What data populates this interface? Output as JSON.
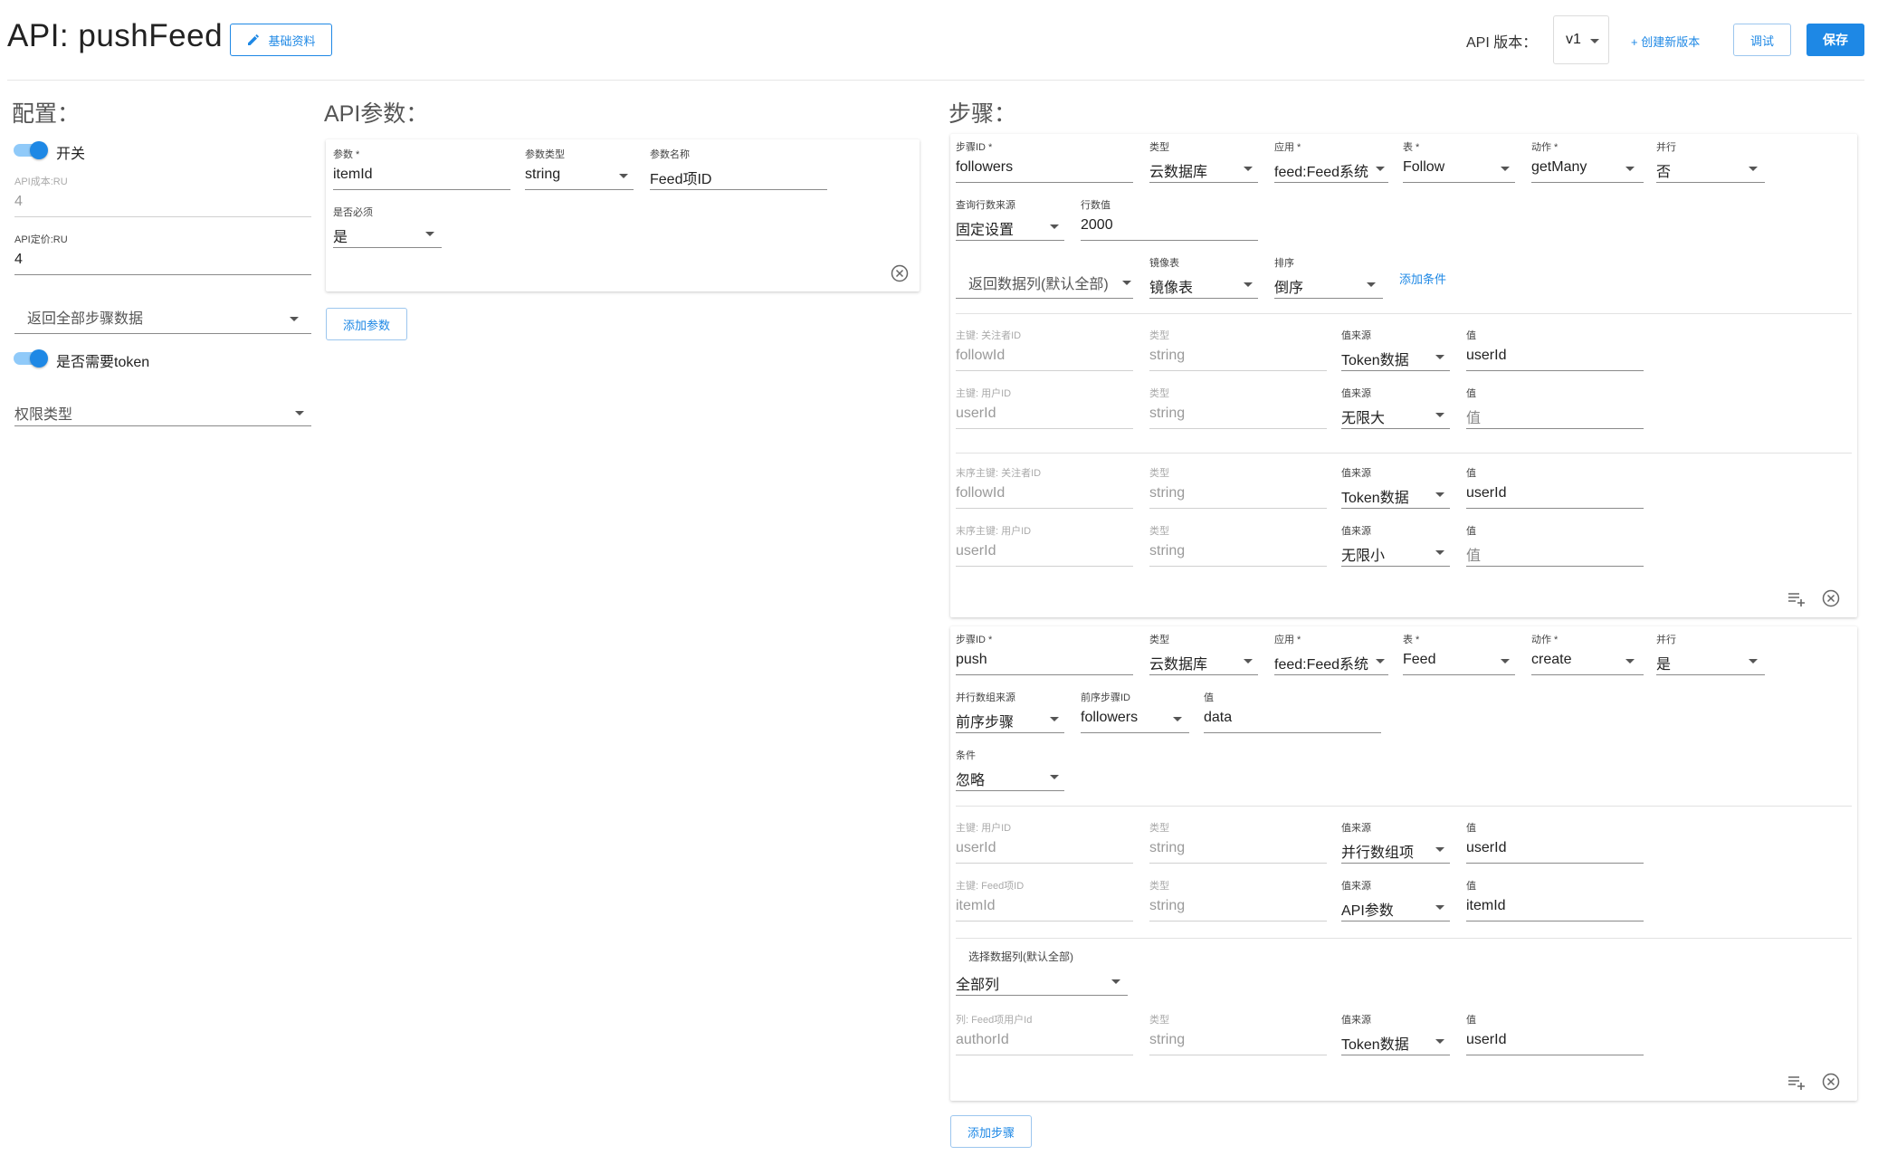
{
  "header": {
    "title": "API: pushFeed",
    "basic_info_btn": "基础资料",
    "version_label": "API 版本：",
    "version_value": "v1",
    "new_version": "+ 创建新版本",
    "debug": "调试",
    "save": "保存"
  },
  "config": {
    "title": "配置：",
    "switch_label": "开关",
    "cost_label": "API成本:RU",
    "cost_value": "4",
    "price_label": "API定价:RU",
    "price_value": "4",
    "return_select": "返回全部步骤数据",
    "token_label": "是否需要token",
    "permission_select": "权限类型"
  },
  "params": {
    "title": "API参数：",
    "param_label": "参数 *",
    "param_value": "itemId",
    "type_label": "参数类型",
    "type_value": "string",
    "name_label": "参数名称",
    "name_value": "Feed项ID",
    "required_label": "是否必须",
    "required_value": "是",
    "add_param": "添加参数"
  },
  "steps": {
    "title": "步骤：",
    "add_step": "添加步骤",
    "step1": {
      "id_label": "步骤ID *",
      "id_value": "followers",
      "type_label": "类型",
      "type_value": "云数据库",
      "app_label": "应用 *",
      "app_value": "feed:Feed系统",
      "table_label": "表 *",
      "table_value": "Follow",
      "action_label": "动作 *",
      "action_value": "getMany",
      "parallel_label": "并行",
      "parallel_value": "否",
      "rowsrc_label": "查询行数来源",
      "rowsrc_value": "固定设置",
      "rowval_label": "行数值",
      "rowval_value": "2000",
      "return_cols": "返回数据列(默认全部)",
      "mirror_label": "镜像表",
      "mirror_value": "镜像表",
      "sort_label": "排序",
      "sort_value": "倒序",
      "add_condition": "添加条件",
      "rows": [
        {
          "k_label": "主键: 关注者ID",
          "k_value": "followId",
          "t_label": "类型",
          "t_value": "string",
          "s_label": "值来源",
          "s_value": "Token数据",
          "v_label": "值",
          "v_value": "userId",
          "v_muted": false
        },
        {
          "k_label": "主键: 用户ID",
          "k_value": "userId",
          "t_label": "类型",
          "t_value": "string",
          "s_label": "值来源",
          "s_value": "无限大",
          "v_label": "值",
          "v_value": "值",
          "v_muted": true
        },
        {
          "k_label": "末序主键: 关注者ID",
          "k_value": "followId",
          "t_label": "类型",
          "t_value": "string",
          "s_label": "值来源",
          "s_value": "Token数据",
          "v_label": "值",
          "v_value": "userId",
          "v_muted": false
        },
        {
          "k_label": "末序主键: 用户ID",
          "k_value": "userId",
          "t_label": "类型",
          "t_value": "string",
          "s_label": "值来源",
          "s_value": "无限小",
          "v_label": "值",
          "v_value": "值",
          "v_muted": true
        }
      ]
    },
    "step2": {
      "id_label": "步骤ID *",
      "id_value": "push",
      "type_label": "类型",
      "type_value": "云数据库",
      "app_label": "应用 *",
      "app_value": "feed:Feed系统",
      "table_label": "表 *",
      "table_value": "Feed",
      "action_label": "动作 *",
      "action_value": "create",
      "parallel_label": "并行",
      "parallel_value": "是",
      "arrsrc_label": "并行数组来源",
      "arrsrc_value": "前序步骤",
      "prev_label": "前序步骤ID",
      "prev_value": "followers",
      "val_label": "值",
      "val_value": "data",
      "cond_label": "条件",
      "cond_value": "忽略",
      "rows": [
        {
          "k_label": "主键: 用户ID",
          "k_value": "userId",
          "t_label": "类型",
          "t_value": "string",
          "s_label": "值来源",
          "s_value": "并行数组项",
          "v_label": "值",
          "v_value": "userId"
        },
        {
          "k_label": "主键: Feed项ID",
          "k_value": "itemId",
          "t_label": "类型",
          "t_value": "string",
          "s_label": "值来源",
          "s_value": "API参数",
          "v_label": "值",
          "v_value": "itemId"
        }
      ],
      "select_cols_label": "选择数据列(默认全部)",
      "select_cols_value": "全部列",
      "col_row": {
        "k_label": "列: Feed项用户Id",
        "k_value": "authorId",
        "t_label": "类型",
        "t_value": "string",
        "s_label": "值来源",
        "s_value": "Token数据",
        "v_label": "值",
        "v_value": "userId"
      }
    }
  }
}
